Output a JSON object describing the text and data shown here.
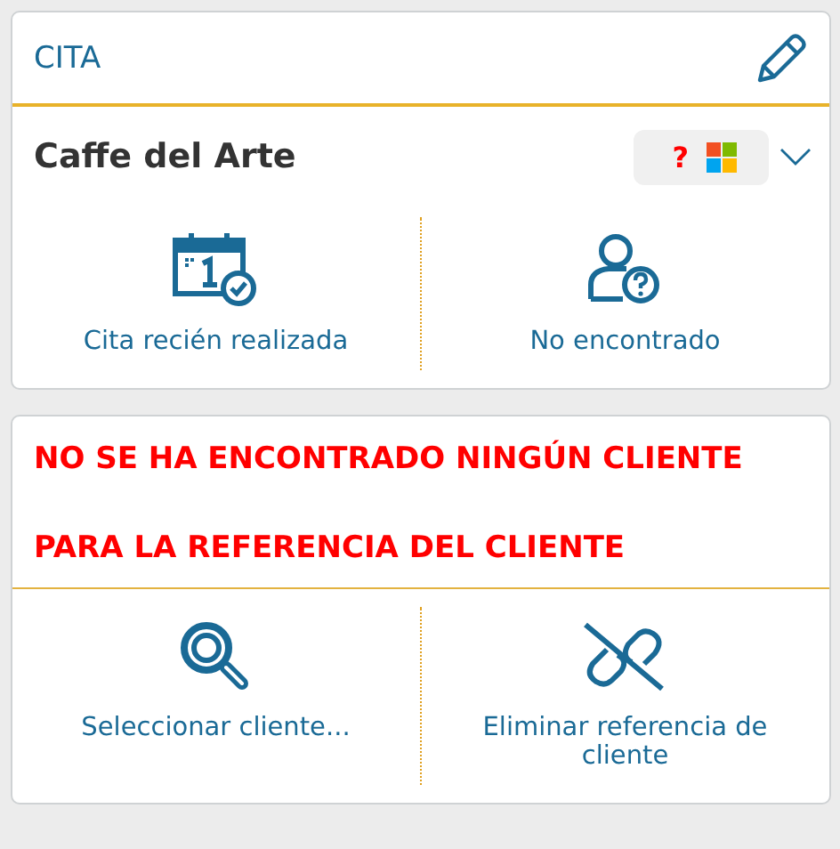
{
  "appointment_card": {
    "title": "CITA",
    "name": "Caffe del Arte",
    "status_badge": {
      "mark": "?"
    },
    "actions": [
      {
        "kind": "calendar",
        "label": "Cita recién realizada"
      },
      {
        "kind": "person",
        "label": "No encontrado"
      }
    ]
  },
  "customer_card": {
    "message_lines": [
      "NO SE HA ENCONTRADO NINGÚN CLIENTE",
      "PARA LA REFERENCIA DEL CLIENTE"
    ],
    "actions": [
      {
        "kind": "search",
        "label": "Seleccionar cliente..."
      },
      {
        "kind": "unlink",
        "label": "Eliminar referencia de cliente"
      }
    ]
  }
}
